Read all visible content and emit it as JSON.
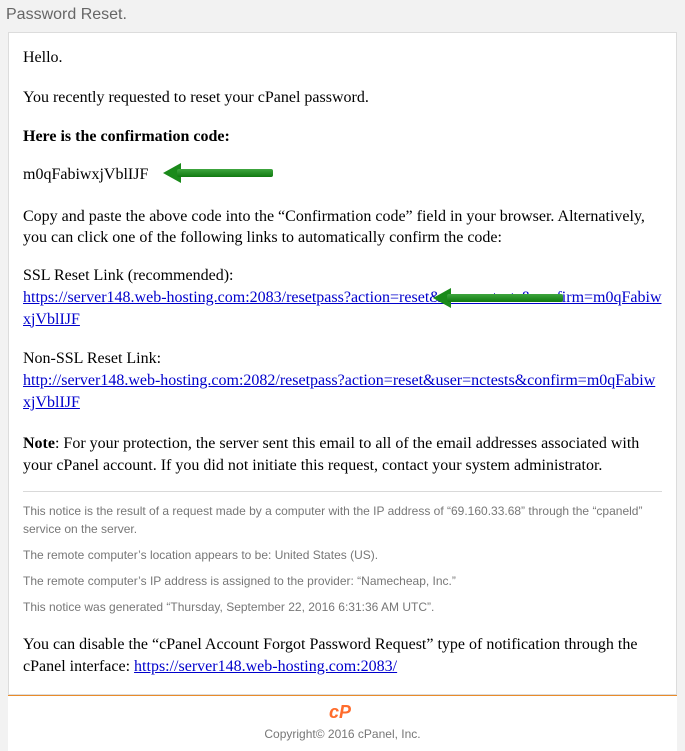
{
  "title": "Password Reset.",
  "body": {
    "greeting": "Hello.",
    "intro": "You recently requested to reset your cPanel password.",
    "code_heading": "Here is the confirmation code:",
    "confirmation_code": "m0qFabiwxjVblIJF",
    "instructions": "Copy and paste the above code into the “Confirmation code” field in your browser. Alternatively, you can click one of the following links to automatically confirm the code:",
    "ssl_label": "SSL Reset Link (recommended):",
    "ssl_link": "https://server148.web-hosting.com:2083/resetpass?action=reset&user=nctests&confirm=m0qFabiwxjVblIJF",
    "nonssl_label": "Non-SSL Reset Link:",
    "nonssl_link": "http://server148.web-hosting.com:2082/resetpass?action=reset&user=nctests&confirm=m0qFabiwxjVblIJF",
    "note_label": "Note",
    "note_text": ": For your protection, the server sent this email to all of the email addresses associated with your cPanel account. If you did not initiate this request, contact your system administrator.",
    "notice1": "This notice is the result of a request made by a computer with the IP address of “69.160.33.68” through the “cpaneld” service on the server.",
    "notice2": "The remote computer’s location appears to be: United States (US).",
    "notice3": "The remote computer’s IP address is assigned to the provider: “Namecheap, Inc.”",
    "notice4": "This notice was generated “Thursday, September 22, 2016 6:31:36 AM UTC”.",
    "disable_prefix": "You can disable the “cPanel Account Forgot Password Request” type of notification through the cPanel interface: ",
    "disable_link": "https://server148.web-hosting.com:2083/"
  },
  "footer": {
    "copyright": "Copyright© 2016 cPanel, Inc."
  }
}
